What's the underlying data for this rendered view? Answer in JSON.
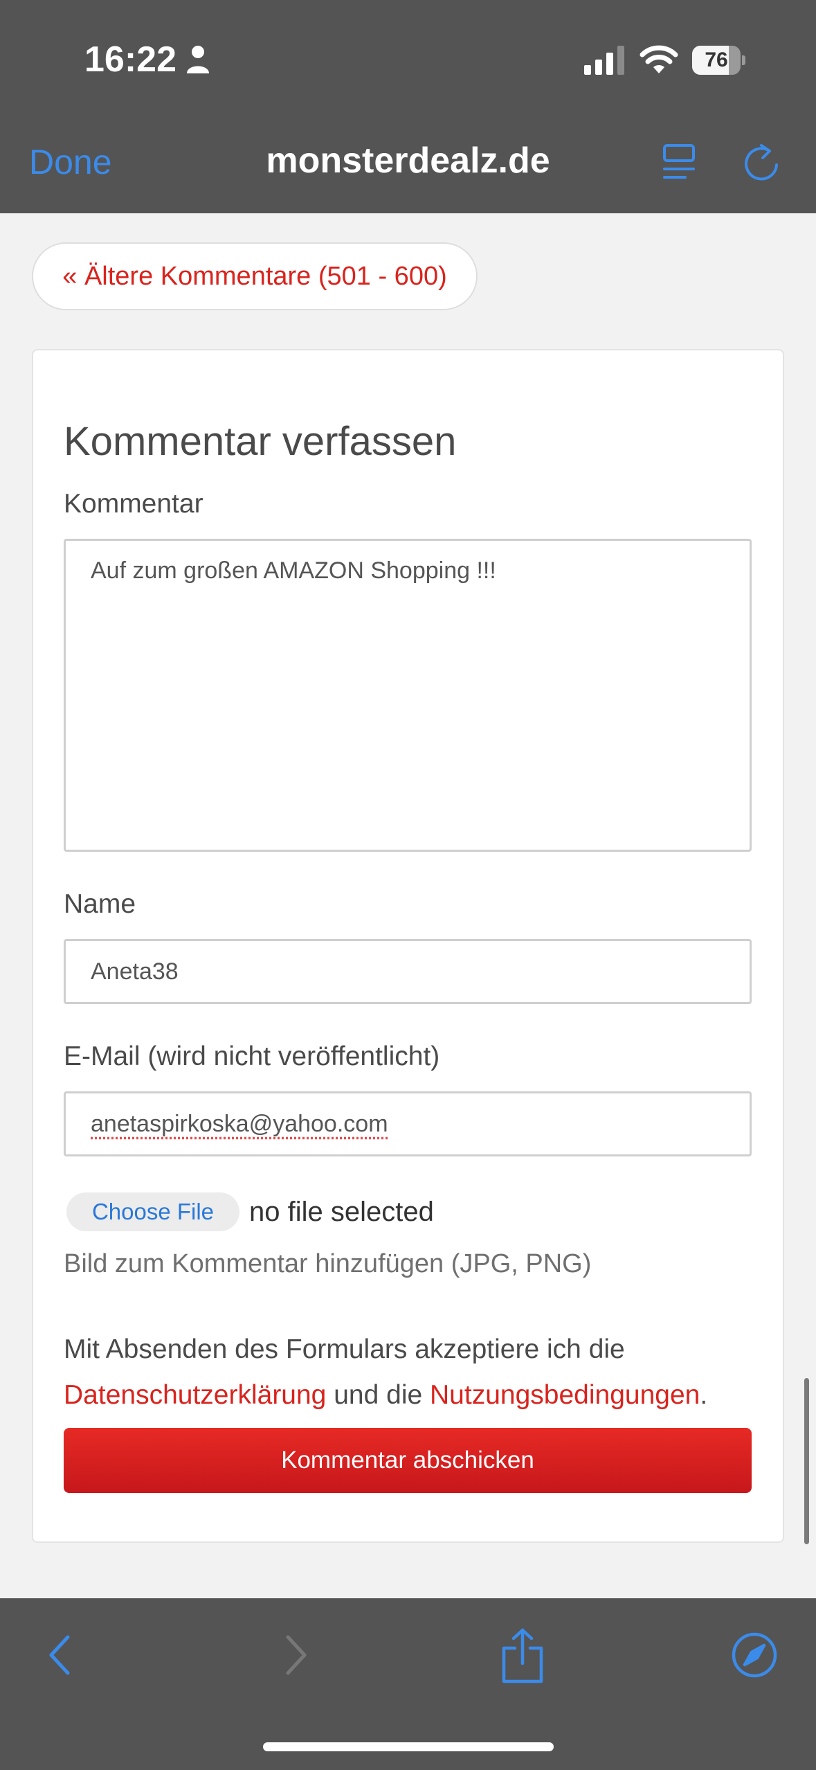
{
  "status_bar": {
    "time": "16:22",
    "battery": "76",
    "battery_level": 0.76
  },
  "nav_bar": {
    "done_label": "Done",
    "site_title": "monsterdealz.de"
  },
  "older_comments": {
    "label": "« Ältere Kommentare (501 - 600)"
  },
  "form": {
    "heading": "Kommentar verfassen",
    "comment_label": "Kommentar",
    "comment_value": "Auf zum großen AMAZON Shopping !!!",
    "name_label": "Name",
    "name_value": "Aneta38",
    "email_label": "E-Mail (wird nicht veröffentlicht)",
    "email_value": "anetaspirkoska@yahoo.com",
    "choose_file_label": "Choose File",
    "no_file_text": "no file selected",
    "image_hint": "Bild zum Kommentar hinzufügen (JPG, PNG)",
    "consent_prefix": "Mit Absenden des Formulars akzeptiere ich die",
    "privacy_link": "Datenschutzerklärung",
    "consent_middle": "und die",
    "terms_link": "Nutzungsbedingungen",
    "consent_suffix": ".",
    "submit_label": "Kommentar abschicken"
  },
  "colors": {
    "accent_blue": "#3b8bea",
    "brand_red": "#d9231d",
    "bar_gray": "#545454"
  },
  "icons": [
    "person-icon",
    "signal-icon",
    "wifi-icon",
    "reader-icon",
    "reload-icon",
    "back-icon",
    "forward-icon",
    "share-icon",
    "compass-icon"
  ]
}
